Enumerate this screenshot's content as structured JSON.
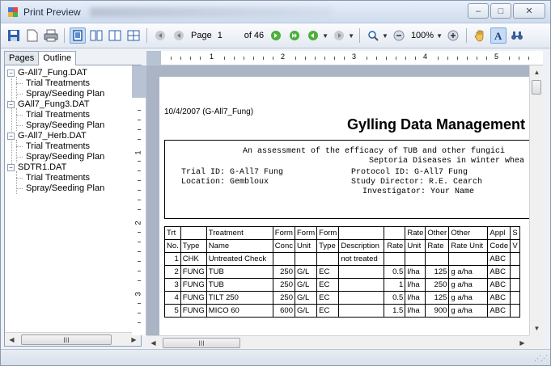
{
  "window": {
    "title": "Print Preview",
    "buttons": {
      "minimize": "–",
      "maximize": "□",
      "close": "✕"
    }
  },
  "toolbar": {
    "page_label": "Page",
    "page_value": "1",
    "of_label": "of 46",
    "zoom_value": "100%"
  },
  "left_pane": {
    "tabs": [
      {
        "label": "Pages",
        "active": false
      },
      {
        "label": "Outline",
        "active": true
      }
    ],
    "tree": [
      {
        "label": "G-All7_Fung.DAT",
        "level": 0
      },
      {
        "label": "Trial Treatments",
        "level": 1
      },
      {
        "label": "Spray/Seeding Plan",
        "level": 1
      },
      {
        "label": "GAll7_Fung3.DAT",
        "level": 0
      },
      {
        "label": "Trial Treatments",
        "level": 1
      },
      {
        "label": "Spray/Seeding Plan",
        "level": 1
      },
      {
        "label": "G-All7_Herb.DAT",
        "level": 0
      },
      {
        "label": "Trial Treatments",
        "level": 1
      },
      {
        "label": "Spray/Seeding Plan",
        "level": 1
      },
      {
        "label": "SDTR1.DAT",
        "level": 0
      },
      {
        "label": "Trial Treatments",
        "level": 1
      },
      {
        "label": "Spray/Seeding Plan",
        "level": 1
      }
    ],
    "scroll_thumb": "III"
  },
  "ruler": {
    "h_numbers": [
      "1",
      "2",
      "3",
      "4",
      "5"
    ],
    "v_numbers": [
      "1",
      "2",
      "3"
    ]
  },
  "document": {
    "date_line": "10/4/2007 (G-All7_Fung)",
    "company": "Gylling Data Management",
    "header": {
      "title1": "An assessment of the efficacy of TUB and other fungici",
      "title2": "Septoria Diseases in winter whea",
      "trial_id": "Trial ID: G-All7 Fung",
      "location": "Location: Gembloux",
      "protocol_id": "Protocol ID: G-All7 Fung",
      "study_director": "Study Director: R.E. Cearch",
      "investigator": "Investigator: Your Name"
    },
    "table": {
      "header_row1": [
        "Trt",
        "",
        "Treatment",
        "Form",
        "Form",
        "Form",
        "",
        "",
        "Rate",
        "Other",
        "Other",
        "Appl",
        "S"
      ],
      "header_row2": [
        "No.",
        "Type",
        "Name",
        "Conc",
        "Unit",
        "Type",
        "Description",
        "Rate",
        "Unit",
        "Rate",
        "Rate Unit",
        "Code",
        "V"
      ],
      "rows": [
        [
          "1",
          "CHK",
          "Untreated Check",
          "",
          "",
          "",
          "not treated",
          "",
          "",
          "",
          "",
          "ABC",
          ""
        ],
        [
          "2",
          "FUNG",
          "TUB",
          "250",
          "G/L",
          "EC",
          "",
          "0.5",
          "l/ha",
          "125",
          "g a/ha",
          "ABC",
          ""
        ],
        [
          "3",
          "FUNG",
          "TUB",
          "250",
          "G/L",
          "EC",
          "",
          "1",
          "l/ha",
          "250",
          "g a/ha",
          "ABC",
          ""
        ],
        [
          "4",
          "FUNG",
          "TILT 250",
          "250",
          "G/L",
          "EC",
          "",
          "0.5",
          "l/ha",
          "125",
          "g a/ha",
          "ABC",
          ""
        ],
        [
          "5",
          "FUNG",
          "MICO 60",
          "600",
          "G/L",
          "EC",
          "",
          "1.5",
          "l/ha",
          "900",
          "g a/ha",
          "ABC",
          ""
        ]
      ]
    }
  },
  "scrollbars": {
    "h_thumb": "III"
  }
}
